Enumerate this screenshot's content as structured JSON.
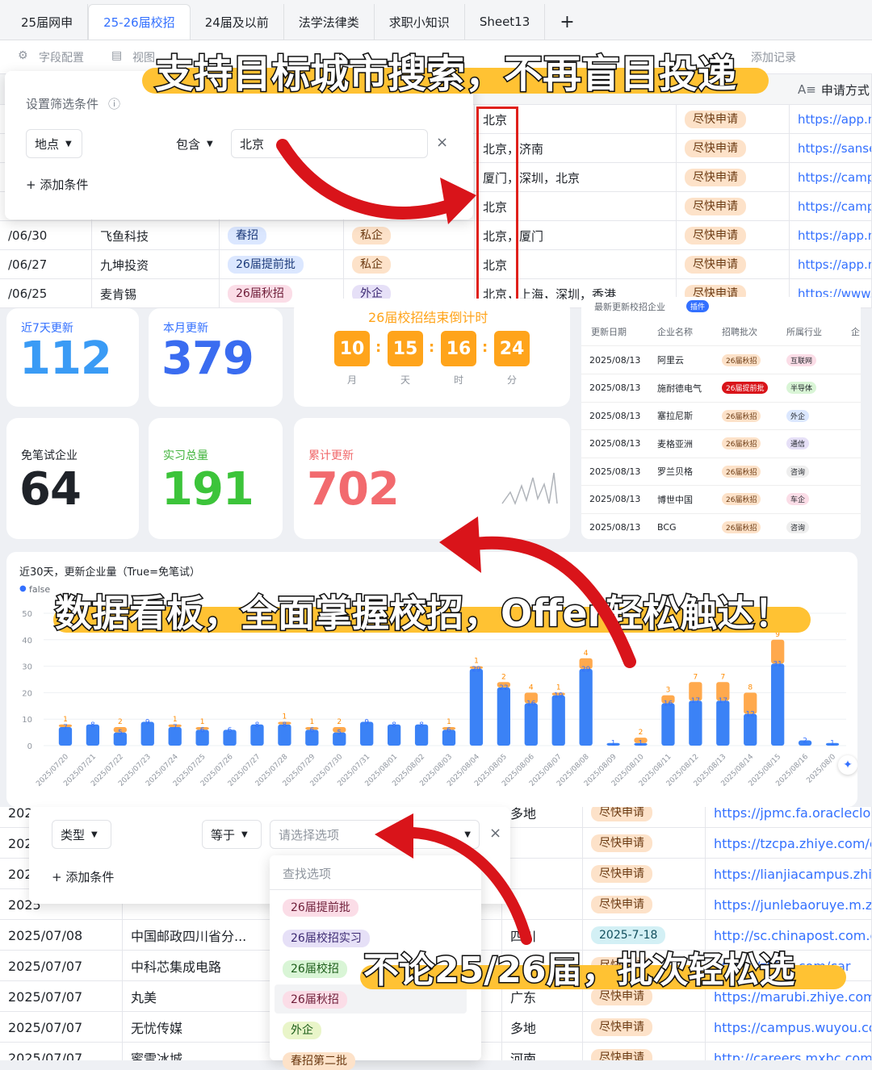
{
  "tabs": [
    "25届网申",
    "25-26届校招",
    "24届及以前",
    "法学法律类",
    "求职小知识",
    "Sheet13"
  ],
  "tab_plus": "+",
  "toolbar": {
    "field_config": "字段配置",
    "view": "视图",
    "add_record": "添加记录"
  },
  "columns": {
    "apply_method": "申请方式"
  },
  "filter1": {
    "title": "设置筛选条件",
    "field": "地点",
    "op": "包含",
    "value": "北京",
    "add": "+ 添加条件",
    "close": "×"
  },
  "grid1": {
    "rows": [
      {
        "date": "",
        "company": "",
        "batch": "",
        "type": "",
        "loc": "北京",
        "status": "尽快申请",
        "url": "https://app.m"
      },
      {
        "date": "",
        "company": "",
        "batch": "",
        "type": "",
        "loc": "北京，济南",
        "status": "尽快申请",
        "url": "https://sanse"
      },
      {
        "date": "",
        "company": "",
        "batch": "",
        "type": "",
        "loc": "厦门，深圳，北京",
        "status": "尽快申请",
        "url": "https://camp"
      },
      {
        "date": "",
        "company": "",
        "batch": "",
        "type": "",
        "loc": "北京",
        "status": "尽快申请",
        "url": "https://camp"
      },
      {
        "date": "/06/30",
        "company": "飞鱼科技",
        "batch": "春招",
        "type": "私企",
        "loc": "北京，厦门",
        "status": "尽快申请",
        "url": "https://app.m"
      },
      {
        "date": "/06/27",
        "company": "九坤投资",
        "batch": "26届提前批",
        "type": "私企",
        "loc": "北京",
        "status": "尽快申请",
        "url": "https://app.m"
      },
      {
        "date": "/06/25",
        "company": "麦肯锡",
        "batch": "26届秋招",
        "type": "外企",
        "loc": "北京，上海，深圳，香港",
        "status": "尽快申请",
        "url": "https://www."
      }
    ]
  },
  "captions": {
    "c1": "支持目标城市搜索，不再盲目投递",
    "c2": "数据看板，全面掌握校招，Offer轻松触达！",
    "c3": "不论25/26届，批次轻松选"
  },
  "stats": {
    "week_label": "近7天更新",
    "week": "112",
    "month_label": "本月更新",
    "month": "379",
    "cd_title": "26届校招结束倒计时",
    "cd": [
      {
        "v": "10",
        "u": "月"
      },
      {
        "v": "15",
        "u": "天"
      },
      {
        "v": "16",
        "u": "时"
      },
      {
        "v": "24",
        "u": "分"
      }
    ],
    "nowritten_label": "免笔试企业",
    "nowritten": "64",
    "intern_label": "实习总量",
    "intern": "191",
    "total_label": "累计更新",
    "total": "702"
  },
  "latest": {
    "title": "最新更新校招企业",
    "badge": "插件",
    "headers": [
      "更新日期",
      "企业名称",
      "招聘批次",
      "所属行业",
      "企"
    ],
    "rows": [
      {
        "date": "2025/08/13",
        "co": "阿里云",
        "batch": "26届秋招",
        "ind": "互联网"
      },
      {
        "date": "2025/08/13",
        "co": "施耐德电气",
        "batch": "26届提前批",
        "ind": "半导体"
      },
      {
        "date": "2025/08/13",
        "co": "塞拉尼斯",
        "batch": "26届秋招",
        "ind": "外企"
      },
      {
        "date": "2025/08/13",
        "co": "麦格亚洲",
        "batch": "26届秋招",
        "ind": "通信"
      },
      {
        "date": "2025/08/13",
        "co": "罗兰贝格",
        "batch": "26届秋招",
        "ind": "咨询"
      },
      {
        "date": "2025/08/13",
        "co": "博世中国",
        "batch": "26届秋招",
        "ind": "车企"
      },
      {
        "date": "2025/08/13",
        "co": "BCG",
        "batch": "26届秋招",
        "ind": "咨询"
      }
    ]
  },
  "chart_data": {
    "type": "bar",
    "title": "近30天，更新企业量（True=免笔试）",
    "legend": [
      "false"
    ],
    "ylim": [
      0,
      50
    ],
    "yticks": [
      0,
      10,
      20,
      30,
      40,
      50
    ],
    "categories": [
      "2025/07/20",
      "2025/07/21",
      "2025/07/22",
      "2025/07/23",
      "2025/07/24",
      "2025/07/25",
      "2025/07/26",
      "2025/07/27",
      "2025/07/28",
      "2025/07/29",
      "2025/07/30",
      "2025/07/31",
      "2025/08/01",
      "2025/08/02",
      "2025/08/03",
      "2025/08/04",
      "2025/08/05",
      "2025/08/06",
      "2025/08/07",
      "2025/08/08",
      "2025/08/09",
      "2025/08/10",
      "2025/08/11",
      "2025/08/12",
      "2025/08/13",
      "2025/08/14",
      "2025/08/15",
      "2025/08/16",
      "2025/08/0"
    ],
    "series": [
      {
        "name": "false",
        "values": [
          7,
          8,
          5,
          9,
          7,
          6,
          6,
          8,
          8,
          6,
          5,
          9,
          8,
          8,
          6,
          29,
          22,
          16,
          19,
          29,
          1,
          1,
          16,
          17,
          17,
          12,
          31,
          2,
          1
        ]
      },
      {
        "name": "True",
        "values": [
          1,
          0,
          2,
          0,
          1,
          1,
          0,
          0,
          1,
          1,
          2,
          0,
          0,
          0,
          1,
          1,
          2,
          4,
          1,
          4,
          0,
          2,
          3,
          7,
          7,
          8,
          9,
          0,
          0
        ]
      }
    ]
  },
  "filter2": {
    "field": "类型",
    "op": "等于",
    "placeholder": "请选择选项",
    "add": "+ 添加条件",
    "close": "×",
    "search": "查找选项",
    "options": [
      "26届提前批",
      "26届校招实习",
      "26届校招",
      "26届秋招",
      "外企",
      "春招第二批"
    ]
  },
  "grid2": {
    "rows": [
      {
        "date": "2025",
        "company": "",
        "loc": "多地",
        "status": "尽快申请",
        "url": "https://jpmc.fa.oraclecloud"
      },
      {
        "date": "2025",
        "company": "",
        "loc": "",
        "status": "尽快申请",
        "url": "https://tzcpa.zhiye.com/ca"
      },
      {
        "date": "2025",
        "company": "",
        "loc": "",
        "status": "尽快申请",
        "url": "https://lianjiacampus.zhiye"
      },
      {
        "date": "2025",
        "company": "",
        "loc": "",
        "status": "尽快申请",
        "url": "https://junlebaoruye.m.zhi"
      },
      {
        "date": "2025/07/08",
        "company": "中国邮政四川省分...",
        "loc": "四川",
        "status": "2025-7-18",
        "url": "http://sc.chinapost.com.cn"
      },
      {
        "date": "2025/07/07",
        "company": "中科芯集成电路",
        "loc": "",
        "status": "尽快申请",
        "url": "https://zhiye.com/car"
      },
      {
        "date": "2025/07/07",
        "company": "丸美",
        "loc": "广东",
        "status": "尽快申请",
        "url": "https://marubi.zhiye.com/("
      },
      {
        "date": "2025/07/07",
        "company": "无忧传媒",
        "loc": "多地",
        "status": "尽快申请",
        "url": "https://campus.wuyou.com"
      },
      {
        "date": "2025/07/07",
        "company": "蜜雪冰城",
        "loc": "河南",
        "status": "尽快申请",
        "url": "http://careers.mxbc.com/s"
      }
    ]
  }
}
